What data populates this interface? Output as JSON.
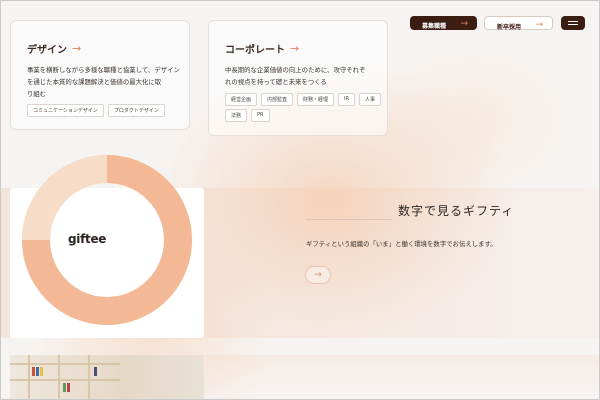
{
  "header": {
    "careers_label": "募集職種",
    "new_grad_label": "新卒採用",
    "arrow": "→"
  },
  "cards": [
    {
      "title": "デザイン",
      "arrow": "→",
      "description_lines": [
        "事業を横断しながら多様な職種と協業して、デザイン",
        "を通じた本質的な課題解決と価値の最大化に取",
        "り組む"
      ],
      "tags": [
        "コミュニケーションデザイン",
        "プロダクトデザイン"
      ]
    },
    {
      "title": "コーポレート",
      "arrow": "→",
      "description_lines": [
        "中長期的な企業価値の向上のために、攻守それぞ",
        "れの視点を持って礎と未来をつくる"
      ],
      "tags_row1": [
        "経営企画",
        "内部監査",
        "財務・経理",
        "IR",
        "人事"
      ],
      "tags_row2": [
        "法務",
        "PR"
      ]
    }
  ],
  "numbers_section": {
    "logo_text": "giftee",
    "heading": "数字で見るギフティ",
    "subtitle": "ギフティという組織の「いま」と働く環境を数字でお伝えします。",
    "button_arrow": "→"
  },
  "colors": {
    "accent": "#e0865a",
    "dark": "#3b1d12",
    "donut_outer": "#f3c3a3",
    "donut_inner": "#f0a777"
  }
}
